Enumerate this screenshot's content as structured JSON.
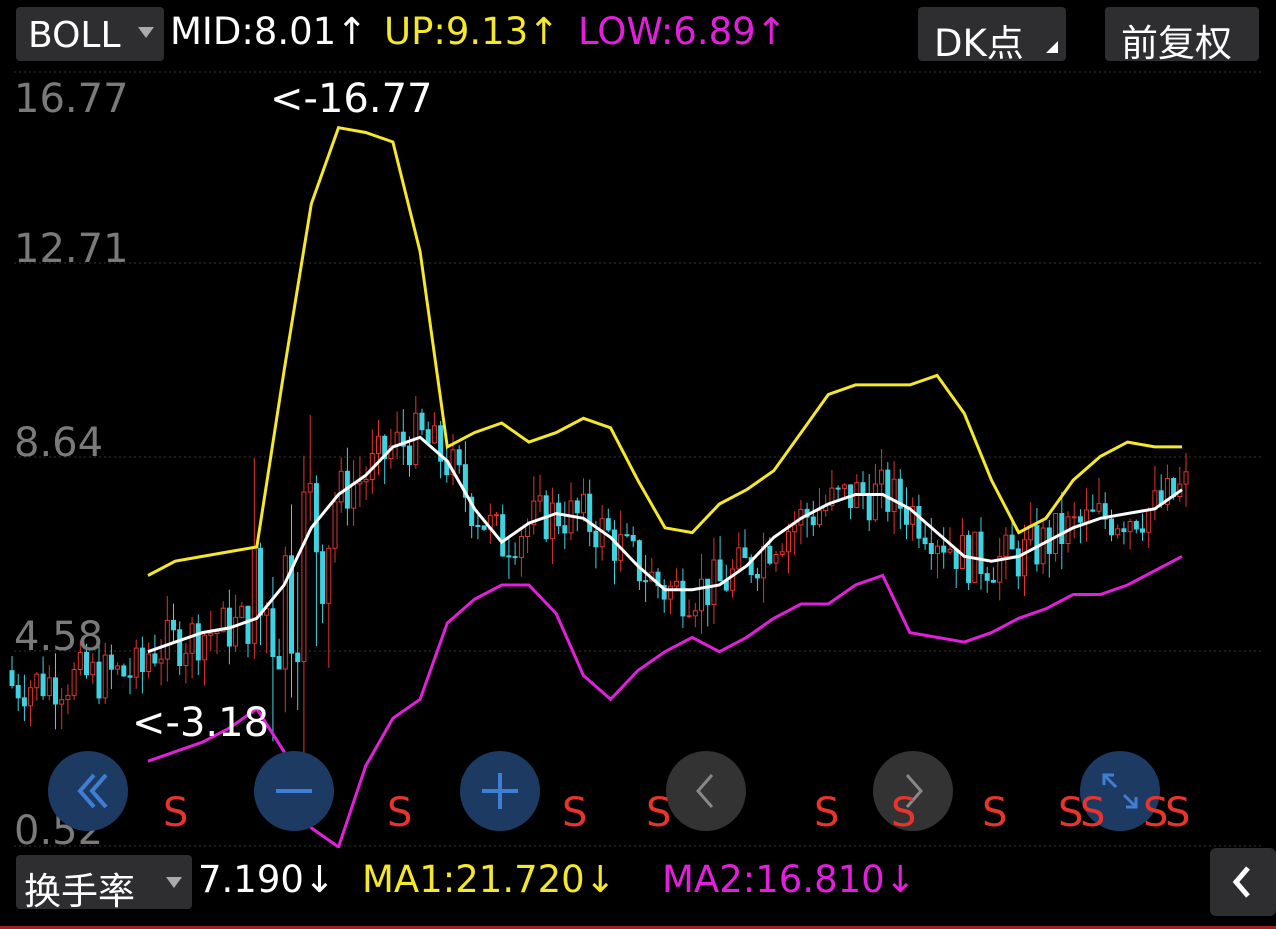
{
  "top_bar": {
    "indicator_select": "BOLL",
    "mid": "MID:8.01",
    "mid_arrow": "↑",
    "up": "UP:9.13",
    "up_arrow": "↑",
    "low": "LOW:6.89",
    "low_arrow": "↑",
    "dk_button": "DK点",
    "fuquan_button": "前复权"
  },
  "colors": {
    "mid": "#ffffff",
    "up": "#f5e82a",
    "low": "#e21fdb",
    "rise": "#e0342c",
    "fall": "#3fd2e0",
    "panel": "#2e2e30",
    "button_blue": "#1d3a63",
    "button_gray": "#333333"
  },
  "chart": {
    "y_labels": [
      "16.77",
      "12.71",
      "8.64",
      "4.58",
      "0.52"
    ],
    "max_label": "<-16.77",
    "min_label": "<-3.18",
    "s_marker": "S",
    "icons": [
      "double-chevron-left-icon",
      "minus-icon",
      "plus-icon",
      "chevron-left-icon",
      "chevron-right-icon",
      "expand-icon"
    ]
  },
  "chart_data": {
    "type": "line",
    "title": "",
    "y_ticks": [
      16.77,
      12.71,
      8.64,
      4.58,
      0.52
    ],
    "series": [
      {
        "name": "MID",
        "values": [
          4.6,
          4.8,
          5.0,
          5.1,
          5.3,
          6.0,
          7.2,
          7.9,
          8.3,
          8.9,
          9.1,
          8.6,
          7.6,
          6.9,
          7.3,
          7.5,
          7.4,
          7.0,
          6.4,
          5.9,
          5.9,
          6.0,
          6.4,
          7.0,
          7.4,
          7.7,
          7.9,
          7.9,
          7.6,
          7.1,
          6.6,
          6.5,
          6.6,
          6.9,
          7.2,
          7.4,
          7.5,
          7.6,
          8.0
        ]
      },
      {
        "name": "UP",
        "values": [
          6.2,
          6.5,
          6.6,
          6.7,
          6.8,
          10.5,
          14.0,
          15.6,
          15.5,
          15.3,
          13.0,
          8.9,
          9.2,
          9.4,
          9.0,
          9.2,
          9.5,
          9.3,
          8.2,
          7.2,
          7.1,
          7.7,
          8.0,
          8.4,
          9.2,
          10.0,
          10.2,
          10.2,
          10.2,
          10.4,
          9.6,
          8.2,
          7.1,
          7.4,
          8.2,
          8.7,
          9.0,
          8.9,
          8.9
        ]
      },
      {
        "name": "LOW",
        "values": [
          2.3,
          2.5,
          2.7,
          3.0,
          3.4,
          2.5,
          0.9,
          0.5,
          2.2,
          3.2,
          3.6,
          5.2,
          5.7,
          6.0,
          6.0,
          5.4,
          4.1,
          3.6,
          4.2,
          4.6,
          4.9,
          4.6,
          4.9,
          5.3,
          5.6,
          5.6,
          6.0,
          6.2,
          5.0,
          4.9,
          4.8,
          5.0,
          5.3,
          5.5,
          5.8,
          5.8,
          6.0,
          6.3,
          6.6
        ]
      }
    ],
    "price_min_label": "<-3.18",
    "price_max_label": "<-16.77"
  },
  "bottom_bar": {
    "indicator_select": "换手率",
    "value": "7.190",
    "value_arrow": "↓",
    "ma1": "MA1:21.720",
    "ma1_arrow": "↓",
    "ma2": "MA2:16.810",
    "ma2_arrow": "↓"
  }
}
